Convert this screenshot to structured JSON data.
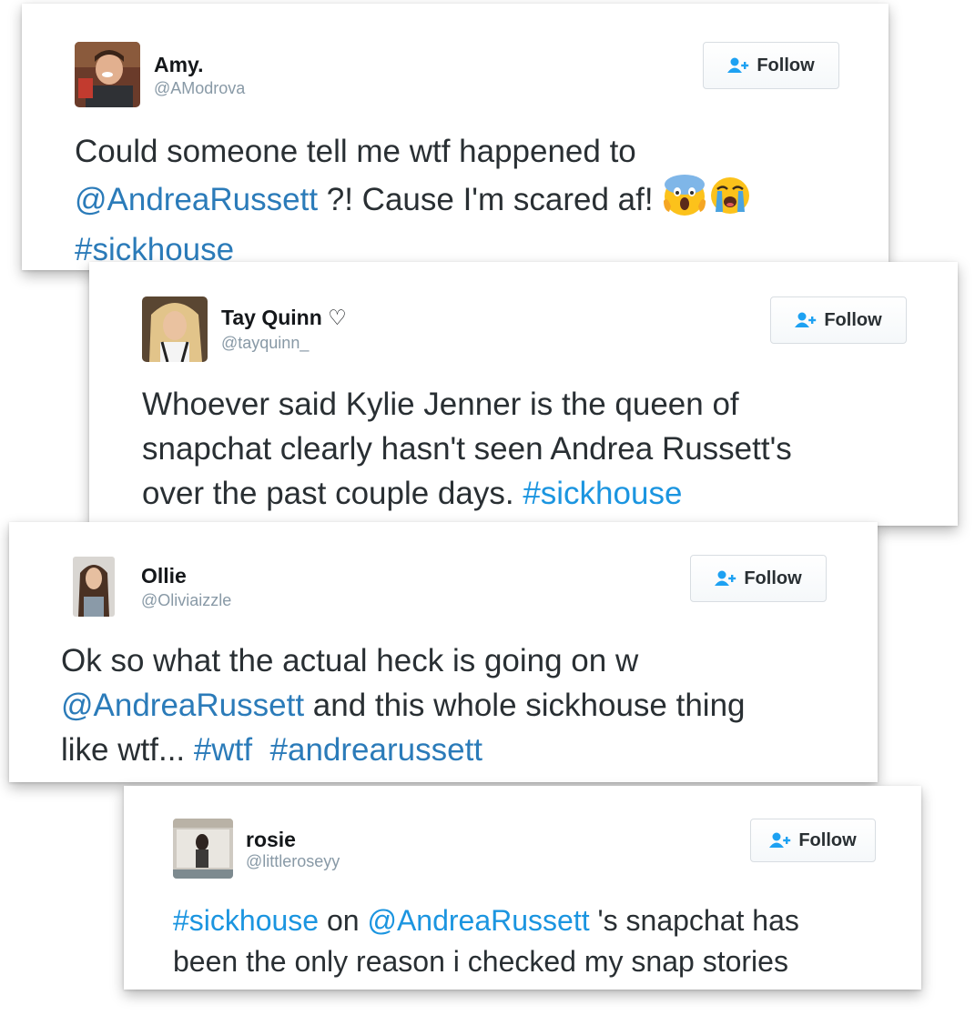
{
  "colors": {
    "link": "#1b95e0",
    "text": "#292f33",
    "handle": "#8899a6",
    "follow_icon": "#1da1f2"
  },
  "tweets": [
    {
      "name": "Amy.",
      "handle": "@AModrova",
      "follow_label": "Follow",
      "text": {
        "l1": "Could someone tell me wtf happened to",
        "l2_mention": "@AndreaRussett",
        "l2_rest": " ?! Cause I'm scared af! ",
        "l3_hashtag": "#sickhouse"
      },
      "emojis": [
        "face-screaming-in-fear-icon",
        "loudly-crying-face-icon"
      ]
    },
    {
      "name": "Tay Quinn",
      "name_suffix": "♡",
      "handle": "@tayquinn_",
      "follow_label": "Follow",
      "text": {
        "l1": "Whoever said Kylie Jenner is the queen of",
        "l2": "snapchat clearly hasn't seen Andrea Russett's",
        "l3_rest": "over the past couple days. ",
        "l3_hashtag": "#sickhouse"
      }
    },
    {
      "name": "Ollie",
      "handle": "@Oliviaizzle",
      "follow_label": "Follow",
      "text": {
        "l1": "Ok so what the actual heck is going on w",
        "l2_mention": "@AndreaRussett",
        "l2_rest": " and this whole sickhouse thing",
        "l3_rest": "like wtf... ",
        "l3_hashtag1": "#wtf",
        "l3_hashtag2": "#andrearussett"
      }
    },
    {
      "name": "rosie",
      "handle": "@littleroseyy",
      "follow_label": "Follow",
      "text": {
        "l1_hashtag": "#sickhouse",
        "l1_on": " on ",
        "l1_mention": "@AndreaRussett",
        "l1_rest": " 's snapchat has",
        "l2": "been the only reason i checked my snap stories"
      }
    }
  ]
}
